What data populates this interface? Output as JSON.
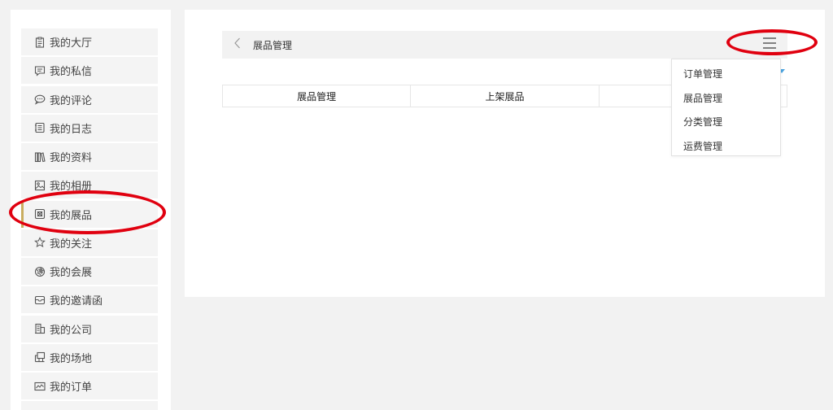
{
  "sidebar": {
    "items": [
      {
        "label": "我的大厅",
        "icon": "clipboard-icon"
      },
      {
        "label": "我的私信",
        "icon": "message-icon"
      },
      {
        "label": "我的评论",
        "icon": "comment-icon"
      },
      {
        "label": "我的日志",
        "icon": "journal-icon"
      },
      {
        "label": "我的资料",
        "icon": "books-icon"
      },
      {
        "label": "我的相册",
        "icon": "image-icon"
      },
      {
        "label": "我的展品",
        "icon": "exhibit-icon"
      },
      {
        "label": "我的关注",
        "icon": "star-icon"
      },
      {
        "label": "我的会展",
        "icon": "globe-icon"
      },
      {
        "label": "我的邀请函",
        "icon": "envelope-icon"
      },
      {
        "label": "我的公司",
        "icon": "building-icon"
      },
      {
        "label": "我的场地",
        "icon": "venue-icon"
      },
      {
        "label": "我的订单",
        "icon": "order-icon"
      }
    ],
    "active_index": 6
  },
  "header": {
    "title": "展品管理",
    "back_icon": "chevron-left-icon",
    "menu_icon": "hamburger-icon"
  },
  "tabs": [
    {
      "label": "展品管理"
    },
    {
      "label": "上架展品"
    },
    {
      "label": ""
    }
  ],
  "dropdown": {
    "items": [
      {
        "label": "订单管理"
      },
      {
        "label": "展品管理"
      },
      {
        "label": "分类管理"
      },
      {
        "label": "运费管理"
      }
    ]
  },
  "colors": {
    "active_accent": "#c9ad60",
    "annotation_red": "#e0000f",
    "caret_blue": "#4aa3df"
  }
}
